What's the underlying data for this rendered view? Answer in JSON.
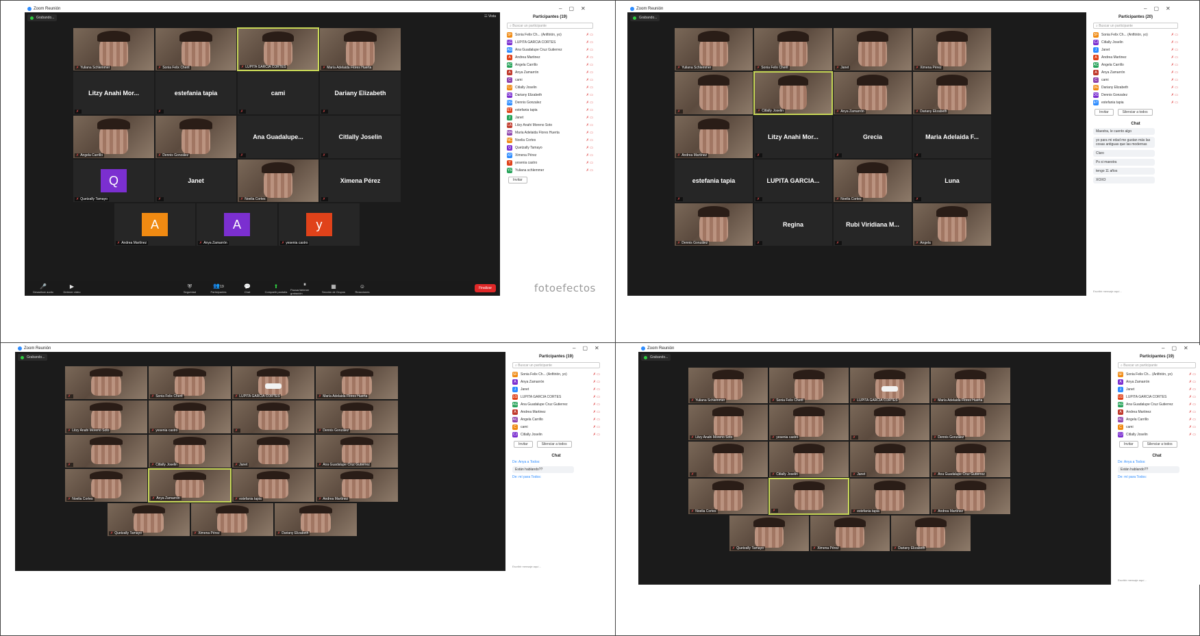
{
  "app_title": "Zoom Reunión",
  "recording_label": "Grabando...",
  "watermark": "fotoefectos",
  "colors": {
    "avatar_q": "#7b2fd0",
    "avatar_a_orange": "#f08a12",
    "avatar_a_purple": "#7b2fd0",
    "avatar_y": "#e0421a",
    "speaker_border": "#c9d958",
    "end_button": "#e02828"
  },
  "top_left": {
    "header_view": "Vista",
    "tiles": [
      {
        "label": "Yuliana Schlemmer",
        "video": true
      },
      {
        "label": "Sonia Felix Cherit",
        "video": true
      },
      {
        "label": "LUPITA GARCIA CORTES",
        "video": true,
        "speaker": true
      },
      {
        "label": "María Adelaida Flores Huerta",
        "video": true
      },
      {
        "name": "Litzy Anahi Mor..."
      },
      {
        "name": "estefania tapia"
      },
      {
        "name": "cami"
      },
      {
        "name": "Dariany Elizabeth"
      },
      {
        "label": "Angela Carrillo",
        "video": true
      },
      {
        "label": "Dennis González",
        "video": true
      },
      {
        "name": "Ana Guadalupe..."
      },
      {
        "name": "Citlally Joselin"
      },
      {
        "label": "Quetzally Tamayo",
        "avatar": "Q"
      },
      {
        "name": "Janet"
      },
      {
        "label": "Noelia Cortes",
        "video": true
      },
      {
        "name": "Ximena Pérez"
      },
      {
        "label": "Andrea Martínez",
        "avatar": "A"
      },
      {
        "label": "Anya Zamarrón",
        "avatar": "A"
      },
      {
        "label": "yesenia castro",
        "avatar": "y"
      }
    ],
    "toolbar": [
      "Desactivar audio",
      "Detener video",
      "Seguridad",
      "Participantes",
      "Chat",
      "Compartir pantalla",
      "Pausar/detener grabación",
      "Sección de Grupos",
      "Reacciones"
    ],
    "participants_count_badge": "19",
    "end_button": "Finalizar",
    "panel_title": "Participantes (19)",
    "search_placeholder": "Buscar un participante",
    "participants": [
      {
        "initials": "SF",
        "name": "Sonia Felix Ch... (Anfitrión, yo)"
      },
      {
        "initials": "LG",
        "name": "LUPITA GARCIA CORTES"
      },
      {
        "initials": "AG",
        "name": "Ana Guadalupe Cruz Gutierrez"
      },
      {
        "initials": "A",
        "name": "Andrea Martinez"
      },
      {
        "initials": "AC",
        "name": "Angela Carrillo"
      },
      {
        "initials": "A",
        "name": "Anya Zamarrón"
      },
      {
        "initials": "C",
        "name": "cami"
      },
      {
        "initials": "CJ",
        "name": "Citlally Joselin"
      },
      {
        "initials": "DE",
        "name": "Dariany Elizabeth"
      },
      {
        "initials": "DG",
        "name": "Dennis Gonzalez"
      },
      {
        "initials": "ET",
        "name": "estefania tapia"
      },
      {
        "initials": "J",
        "name": "Janet"
      },
      {
        "initials": "LA",
        "name": "Litzy Anahi Moreno Soto"
      },
      {
        "initials": "MA",
        "name": "Maria Adelaida Flores Huerta"
      },
      {
        "initials": "NC",
        "name": "Noelia Cortes"
      },
      {
        "initials": "Q",
        "name": "Quetzally Tamayo"
      },
      {
        "initials": "XP",
        "name": "Ximena Pérez"
      },
      {
        "initials": "Y",
        "name": "yesenia castro"
      },
      {
        "initials": "YS",
        "name": "Yuliana schlemmer"
      }
    ],
    "invite_label": "Invitar"
  },
  "top_right": {
    "tiles": [
      {
        "label": "Yuliana Schlemmer",
        "video": true
      },
      {
        "label": "Sonia Felix Cherit",
        "video": true
      },
      {
        "label": "Janet",
        "video": true
      },
      {
        "label": "Ximena Pérez",
        "video": true
      },
      {
        "label": "",
        "video": true
      },
      {
        "label": "Citlally Joselin",
        "video": true,
        "speaker": true
      },
      {
        "label": "Anya Zamarrón",
        "video": true
      },
      {
        "label": "Dariany Elizabeth",
        "video": true
      },
      {
        "label": "Andrea Martínez",
        "video": true
      },
      {
        "name": "Litzy Anahi Mor..."
      },
      {
        "name": "Grecia"
      },
      {
        "name": "Maria Adelaida F..."
      },
      {
        "name": "estefania tapia"
      },
      {
        "name": "LUPITA GARCIA..."
      },
      {
        "label": "Noelia Cortes",
        "video": true
      },
      {
        "name": "Luna"
      },
      {
        "label": "Dennis González",
        "video": true
      },
      {
        "name": "Regina"
      },
      {
        "name": "Rubi Viridiana M..."
      },
      {
        "label": "Angela",
        "video": true
      }
    ],
    "panel_title": "Participantes (20)",
    "search_placeholder": "Buscar un participante",
    "participants": [
      {
        "initials": "SF",
        "name": "Sonia Felix Ch... (Anfitrión, yo)"
      },
      {
        "initials": "CJ",
        "name": "Citlally Joselin"
      },
      {
        "initials": "J",
        "name": "Janet"
      },
      {
        "initials": "A",
        "name": "Andrea Martinez"
      },
      {
        "initials": "AC",
        "name": "Angela Carrillo"
      },
      {
        "initials": "A",
        "name": "Anya Zamarrón"
      },
      {
        "initials": "C",
        "name": "cami"
      },
      {
        "initials": "DE",
        "name": "Dariany Elizabeth"
      },
      {
        "initials": "DG",
        "name": "Dennis Gonzalez"
      },
      {
        "initials": "ET",
        "name": "estefania tapia"
      }
    ],
    "invite_label": "Invitar",
    "mute_all_label": "Silenciar a todos",
    "chat_title": "Chat",
    "chat_messages": [
      "Maestra, le cuento algo",
      "yo para mi edad me gustan más las cosas antiguas que las modernas",
      "Claro",
      "Ps si maestra",
      "tengo 11 años",
      "XOXO"
    ],
    "chat_footer": "Escribir mensaje aquí..."
  },
  "bottom_left": {
    "tiles": [
      {
        "label": "",
        "video": true
      },
      {
        "label": "Sonia Felix Cherit",
        "video": true
      },
      {
        "label": "LUPITA GARCIA CORTES",
        "video": true,
        "mask": true
      },
      {
        "label": "María Adelaida Flores Huerta",
        "video": true
      },
      {
        "label": "Litzy Anahi Moreno Soto",
        "video": true
      },
      {
        "label": "yesenia castro",
        "video": true
      },
      {
        "label": "",
        "video": true
      },
      {
        "label": "Dennis González",
        "video": true
      },
      {
        "label": "",
        "video": true
      },
      {
        "label": "Citlally Joselin",
        "video": true
      },
      {
        "label": "Janet",
        "video": true
      },
      {
        "label": "Ana Guadalupe Cruz Gutierrez",
        "video": true
      },
      {
        "label": "Noelia Cortes",
        "video": true
      },
      {
        "label": "Anya Zamarrón",
        "video": true,
        "speaker": true
      },
      {
        "label": "estefania tapia",
        "video": true
      },
      {
        "label": "Andrea Martínez",
        "video": true
      },
      {
        "label": "Quetzally Tamayo",
        "video": true
      },
      {
        "label": "Ximena Pérez",
        "video": true
      },
      {
        "label": "Dariany Elizabeth",
        "video": true
      }
    ],
    "panel_title": "Participantes (19)",
    "search_placeholder": "Buscar un participante",
    "participants": [
      {
        "initials": "SF",
        "name": "Sonia Felix Ch... (Anfitrión, yo)"
      },
      {
        "initials": "A",
        "name": "Anya Zamarrón"
      },
      {
        "initials": "J",
        "name": "Janet"
      },
      {
        "initials": "LG",
        "name": "LUPITA GARCIA CORTES"
      },
      {
        "initials": "AG",
        "name": "Ana Guadalupe Cruz Gutierrez"
      },
      {
        "initials": "A",
        "name": "Andrea Martinez"
      },
      {
        "initials": "AC",
        "name": "Angela Carrillo"
      },
      {
        "initials": "C",
        "name": "cami"
      },
      {
        "initials": "CJ",
        "name": "Citlally Joselin"
      }
    ],
    "invite_label": "Invitar",
    "mute_all_label": "Silenciar a todos",
    "chat_title": "Chat",
    "chat_meta_1": "De: Anya a Todos:",
    "chat_messages": [
      "Están hablando??"
    ],
    "chat_meta_2": "De: mí para Todos:",
    "chat_footer": "Escribir mensaje aquí..."
  },
  "bottom_right": {
    "tiles": [
      {
        "label": "Yuliana Schlemmer",
        "video": true
      },
      {
        "label": "Sonia Felix Cherit",
        "video": true
      },
      {
        "label": "LUPITA GARCIA CORTES",
        "video": true,
        "mask": true
      },
      {
        "label": "María Adelaida Flores Huerta",
        "video": true
      },
      {
        "label": "Litzy Anahi Moreno Soto",
        "video": true
      },
      {
        "label": "yesenia castro",
        "video": true
      },
      {
        "label": "",
        "video": true
      },
      {
        "label": "Dennis González",
        "video": true
      },
      {
        "label": "",
        "video": true
      },
      {
        "label": "Citlally Joselin",
        "video": true
      },
      {
        "label": "Janet",
        "video": true
      },
      {
        "label": "Ana Guadalupe Cruz Gutierrez",
        "video": true
      },
      {
        "label": "Noelia Cortes",
        "video": true
      },
      {
        "label": "",
        "video": true,
        "speaker": true
      },
      {
        "label": "estefania tapia",
        "video": true
      },
      {
        "label": "Andrea Martínez",
        "video": true
      },
      {
        "label": "Quetzally Tamayo",
        "video": true
      },
      {
        "label": "Ximena Pérez",
        "video": true
      },
      {
        "label": "Dariany Elizabeth",
        "video": true
      }
    ],
    "panel_title": "Participantes (19)",
    "search_placeholder": "Buscar un participante",
    "participants": [
      {
        "initials": "SF",
        "name": "Sonia Felix Ch... (Anfitrión, yo)"
      },
      {
        "initials": "A",
        "name": "Anya Zamarrón"
      },
      {
        "initials": "J",
        "name": "Janet"
      },
      {
        "initials": "LG",
        "name": "LUPITA GARCIA CORTES"
      },
      {
        "initials": "AG",
        "name": "Ana Guadalupe Cruz Gutierrez"
      },
      {
        "initials": "A",
        "name": "Andrea Martinez"
      },
      {
        "initials": "AC",
        "name": "Angela Carrillo"
      },
      {
        "initials": "C",
        "name": "cami"
      },
      {
        "initials": "CJ",
        "name": "Citlally Joselin"
      }
    ],
    "invite_label": "Invitar",
    "mute_all_label": "Silenciar a todos",
    "chat_title": "Chat",
    "chat_meta_1": "De: Anya a Todos:",
    "chat_messages": [
      "Están hablando??"
    ],
    "chat_meta_2": "De: mí para Todos:",
    "chat_footer": "Escribir mensaje aquí..."
  }
}
